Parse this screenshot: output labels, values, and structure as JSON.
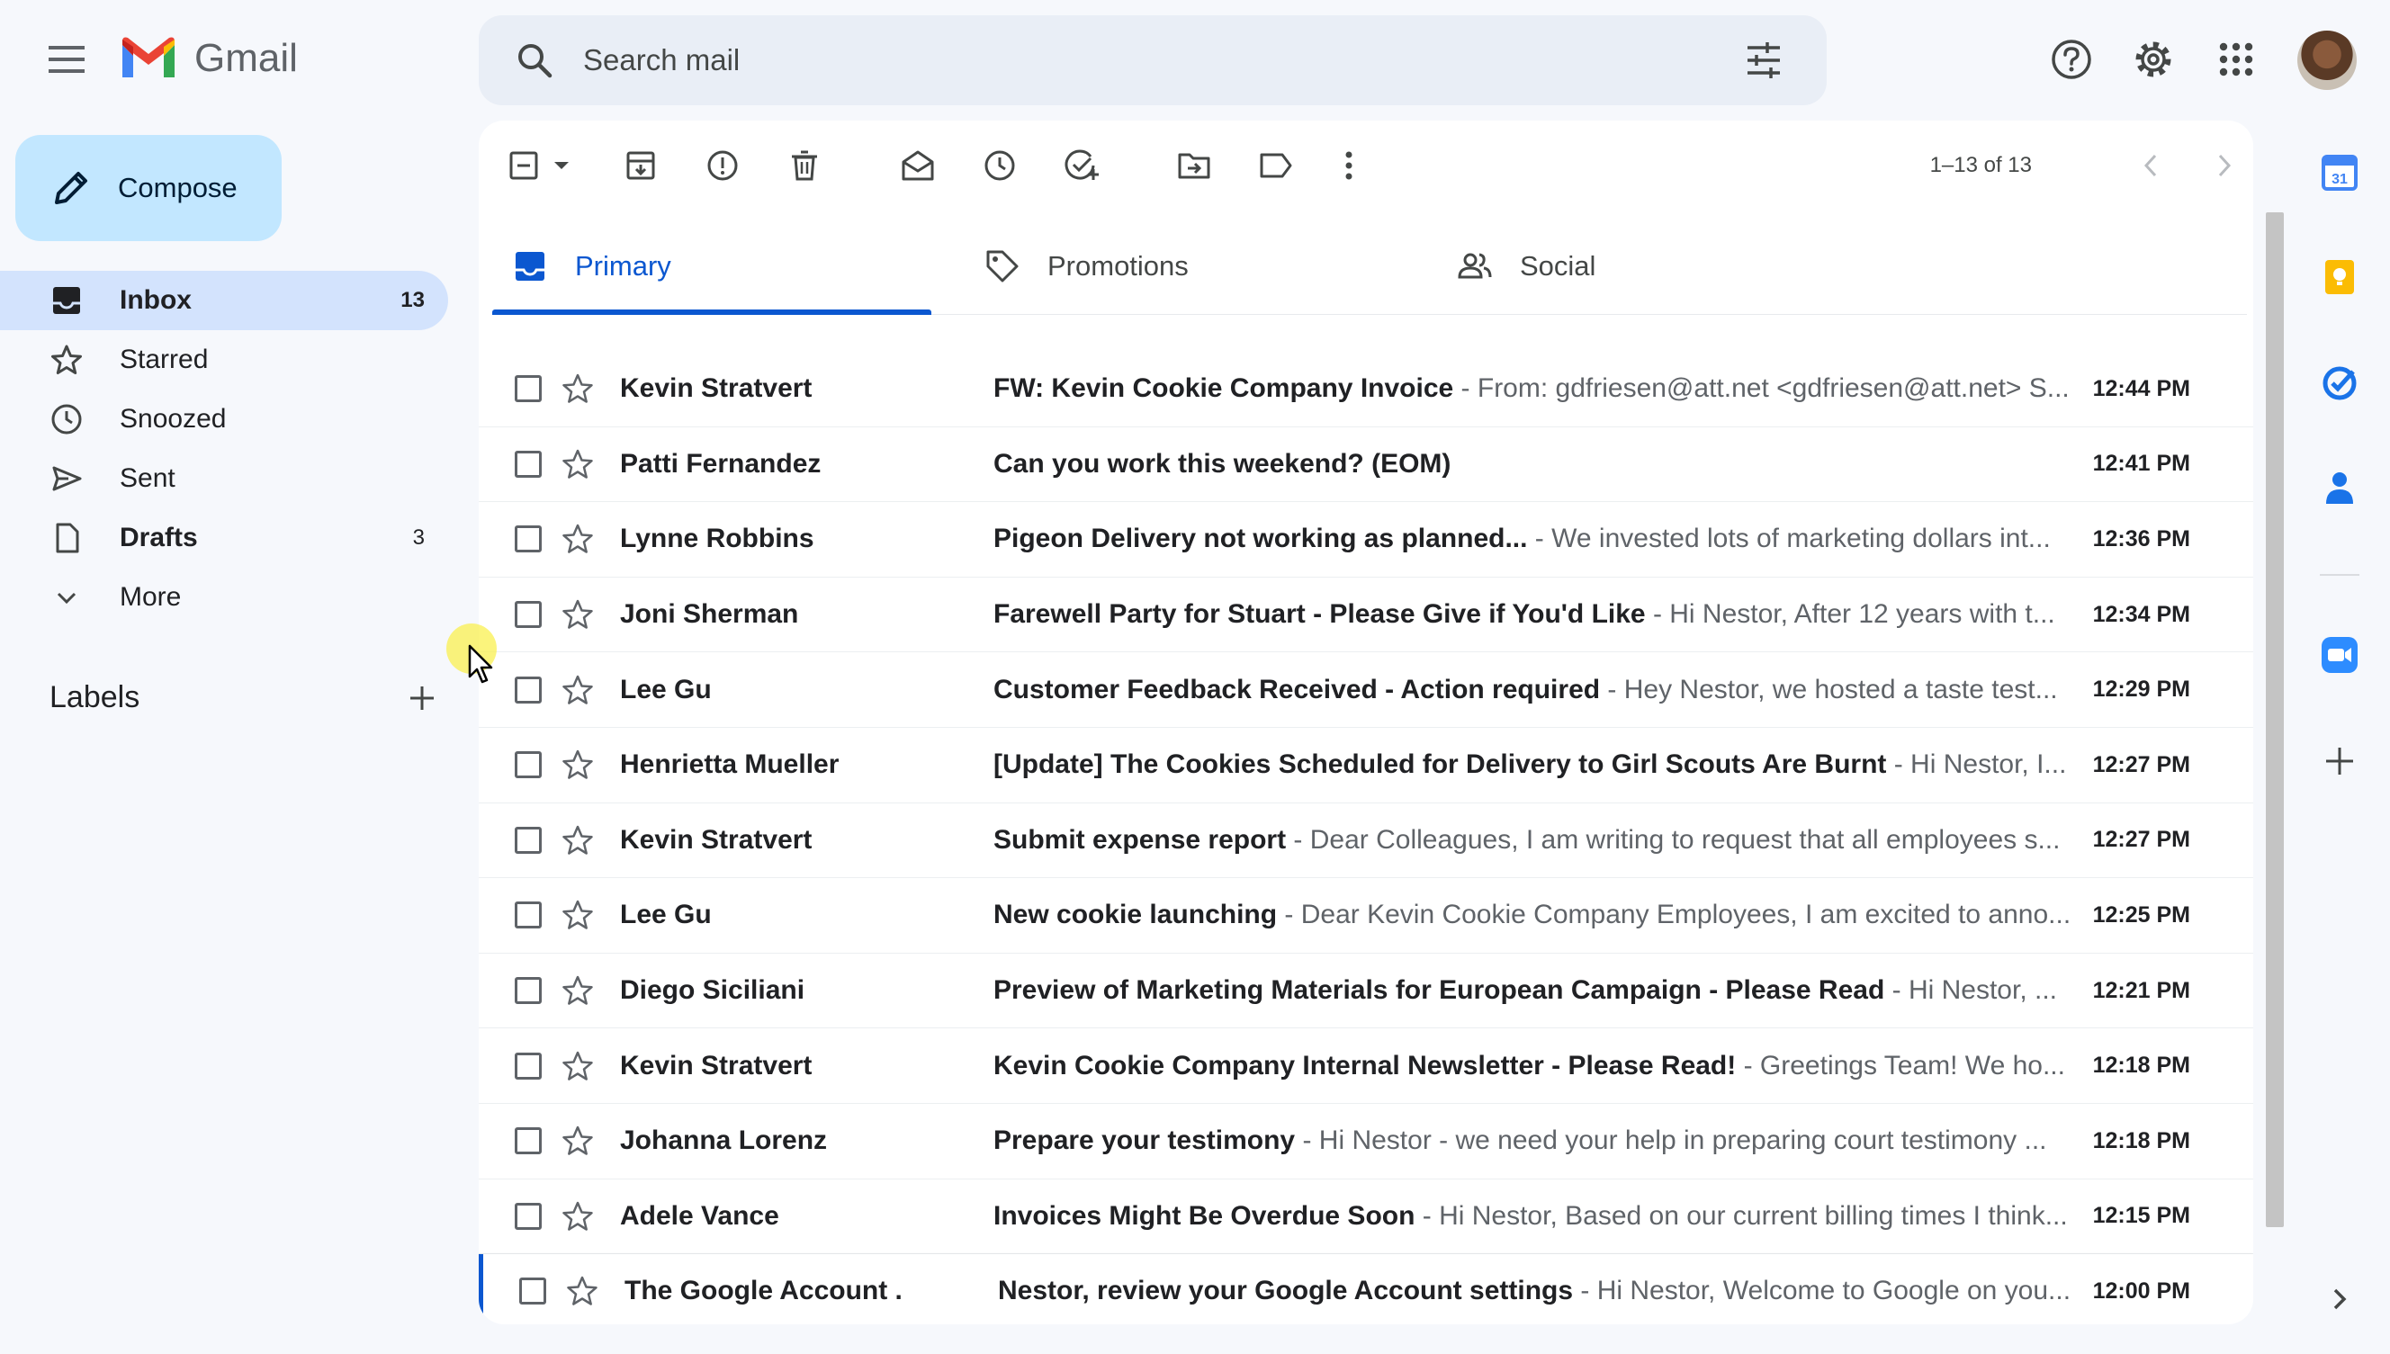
{
  "app": {
    "name": "Gmail"
  },
  "search": {
    "placeholder": "Search mail"
  },
  "compose": {
    "label": "Compose"
  },
  "nav": [
    {
      "label": "Inbox",
      "count": "13",
      "icon": "inbox-icon"
    },
    {
      "label": "Starred",
      "count": "",
      "icon": "star-icon"
    },
    {
      "label": "Snoozed",
      "count": "",
      "icon": "clock-icon"
    },
    {
      "label": "Sent",
      "count": "",
      "icon": "send-icon"
    },
    {
      "label": "Drafts",
      "count": "3",
      "icon": "draft-icon"
    },
    {
      "label": "More",
      "count": "",
      "icon": "chevron-down-icon"
    }
  ],
  "labels": {
    "title": "Labels"
  },
  "pager": {
    "text": "1–13 of 13"
  },
  "tabs": [
    {
      "label": "Primary",
      "icon": "inbox-icon"
    },
    {
      "label": "Promotions",
      "icon": "tag-icon"
    },
    {
      "label": "Social",
      "icon": "people-icon"
    }
  ],
  "emails": [
    {
      "sender": "Kevin Stratvert",
      "subject": "FW: Kevin Cookie Company Invoice",
      "snippet": " - From: gdfriesen@att.net <gdfriesen@att.net> S...",
      "time": "12:44 PM"
    },
    {
      "sender": "Patti Fernandez",
      "subject": "Can you work this weekend? (EOM)",
      "snippet": "",
      "time": "12:41 PM"
    },
    {
      "sender": "Lynne Robbins",
      "subject": "Pigeon Delivery not working as planned...",
      "snippet": " - We invested lots of marketing dollars int...",
      "time": "12:36 PM"
    },
    {
      "sender": "Joni Sherman",
      "subject": "Farewell Party for Stuart - Please Give if You'd Like",
      "snippet": " - Hi Nestor, After 12 years with t...",
      "time": "12:34 PM"
    },
    {
      "sender": "Lee Gu",
      "subject": "Customer Feedback Received - Action required",
      "snippet": " - Hey Nestor, we hosted a taste test...",
      "time": "12:29 PM"
    },
    {
      "sender": "Henrietta Mueller",
      "subject": "[Update] The Cookies Scheduled for Delivery to Girl Scouts Are Burnt",
      "snippet": " - Hi Nestor, I...",
      "time": "12:27 PM"
    },
    {
      "sender": "Kevin Stratvert",
      "subject": "Submit expense report",
      "snippet": " - Dear Colleagues, I am writing to request that all employees s...",
      "time": "12:27 PM"
    },
    {
      "sender": "Lee Gu",
      "subject": "New cookie launching",
      "snippet": " - Dear Kevin Cookie Company Employees, I am excited to anno...",
      "time": "12:25 PM"
    },
    {
      "sender": "Diego Siciliani",
      "subject": "Preview of Marketing Materials for European Campaign - Please Read",
      "snippet": " - Hi Nestor, ...",
      "time": "12:21 PM"
    },
    {
      "sender": "Kevin Stratvert",
      "subject": "Kevin Cookie Company Internal Newsletter - Please Read!",
      "snippet": " - Greetings Team! We ho...",
      "time": "12:18 PM"
    },
    {
      "sender": "Johanna Lorenz",
      "subject": "Prepare your testimony",
      "snippet": " - Hi Nestor - we need your help in preparing court testimony ...",
      "time": "12:18 PM"
    },
    {
      "sender": "Adele Vance",
      "subject": "Invoices Might Be Overdue Soon",
      "snippet": " - Hi Nestor, Based on our current billing times I think...",
      "time": "12:15 PM"
    },
    {
      "sender": "The Google Account .",
      "subject": "Nestor, review your Google Account settings",
      "snippet": " - Hi Nestor, Welcome to Google on you...",
      "time": "12:00 PM"
    }
  ],
  "colors": {
    "accent": "#0b57d0",
    "compose_bg": "#c2e7ff",
    "active_nav": "#d3e3fd",
    "page_bg": "#f6f8fc"
  }
}
